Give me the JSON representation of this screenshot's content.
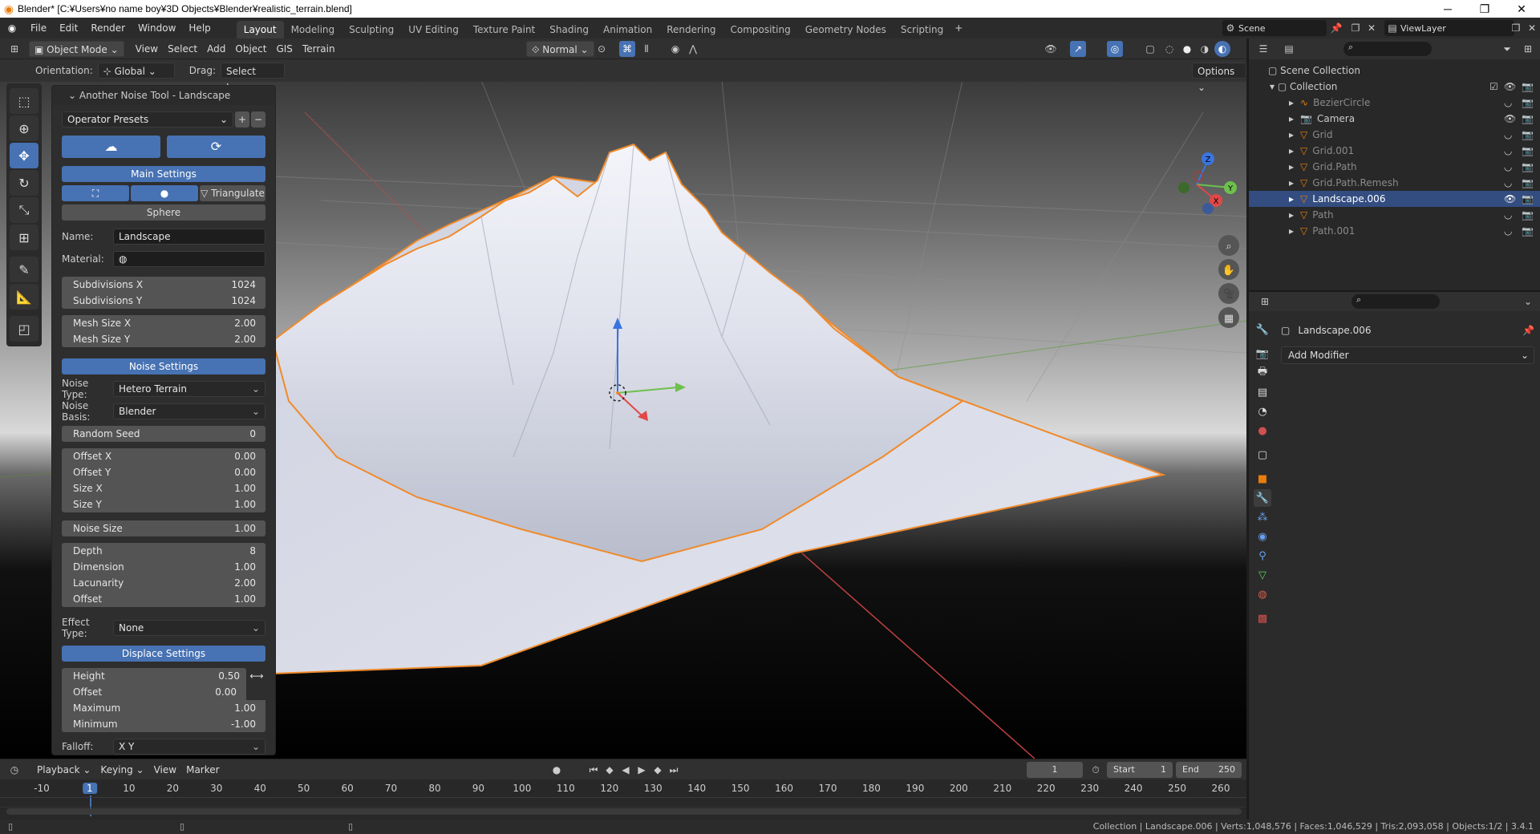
{
  "window": {
    "title": "Blender* [C:¥Users¥no name boy¥3D Objects¥Blender¥realistic_terrain.blend]"
  },
  "menu": [
    "File",
    "Edit",
    "Render",
    "Window",
    "Help"
  ],
  "workspaces": [
    "Layout",
    "Modeling",
    "Sculpting",
    "UV Editing",
    "Texture Paint",
    "Shading",
    "Animation",
    "Rendering",
    "Compositing",
    "Geometry Nodes",
    "Scripting"
  ],
  "scene": {
    "scene_name": "Scene",
    "view_layer": "ViewLayer"
  },
  "viewport_header": {
    "mode": "Object Mode",
    "menus": [
      "View",
      "Select",
      "Add",
      "Object",
      "GIS",
      "Terrain"
    ],
    "transform_orientation": "Normal"
  },
  "tool_header": {
    "orientation_label": "Orientation:",
    "orientation_value": "Global",
    "drag_label": "Drag:",
    "drag_value": "Select La...",
    "options_label": "Options"
  },
  "operator_panel": {
    "title": "Another Noise Tool - Landscape",
    "presets_label": "Operator Presets",
    "main_settings": "Main Settings",
    "triangulate": "Triangulate",
    "sphere": "Sphere",
    "name_label": "Name:",
    "name_value": "Landscape",
    "material_label": "Material:",
    "subdiv_x_label": "Subdivisions X",
    "subdiv_x": "1024",
    "subdiv_y_label": "Subdivisions Y",
    "subdiv_y": "1024",
    "mesh_x_label": "Mesh Size X",
    "mesh_x": "2.00",
    "mesh_y_label": "Mesh Size Y",
    "mesh_y": "2.00",
    "noise_settings": "Noise Settings",
    "noise_type_label": "Noise Type:",
    "noise_type": "Hetero Terrain",
    "noise_basis_label": "Noise Basis:",
    "noise_basis": "Blender",
    "seed_label": "Random Seed",
    "seed": "0",
    "offset_x_label": "Offset X",
    "offset_x": "0.00",
    "offset_y_label": "Offset Y",
    "offset_y": "0.00",
    "size_x_label": "Size X",
    "size_x": "1.00",
    "size_y_label": "Size Y",
    "size_y": "1.00",
    "noise_size_label": "Noise Size",
    "noise_size": "1.00",
    "depth_label": "Depth",
    "depth": "8",
    "dimension_label": "Dimension",
    "dimension": "1.00",
    "lacunarity_label": "Lacunarity",
    "lacunarity": "2.00",
    "offset_label": "Offset",
    "offset": "1.00",
    "effect_type_label": "Effect Type:",
    "effect_type": "None",
    "displace_settings": "Displace Settings",
    "height_label": "Height",
    "height": "0.50",
    "d_offset_label": "Offset",
    "d_offset": "0.00",
    "maximum_label": "Maximum",
    "maximum": "1.00",
    "minimum_label": "Minimum",
    "minimum": "-1.00",
    "falloff_label": "Falloff:",
    "falloff": "X Y"
  },
  "timeline": {
    "menus": [
      "Playback",
      "Keying",
      "View",
      "Marker"
    ],
    "current_frame": "1",
    "start_label": "Start",
    "start": "1",
    "end_label": "End",
    "end": "250",
    "ticks": [
      "-10",
      "1",
      "10",
      "20",
      "30",
      "40",
      "50",
      "60",
      "70",
      "80",
      "90",
      "100",
      "110",
      "120",
      "130",
      "140",
      "150",
      "160",
      "170",
      "180",
      "190",
      "200",
      "210",
      "220",
      "230",
      "240",
      "250",
      "260"
    ]
  },
  "outliner": {
    "root": "Scene Collection",
    "collection": "Collection",
    "items": [
      "BezierCircle",
      "Camera",
      "Grid",
      "Grid.001",
      "Grid.Path",
      "Grid.Path.Remesh",
      "Landscape.006",
      "Path",
      "Path.001"
    ],
    "selected": "Landscape.006"
  },
  "properties": {
    "object_name": "Landscape.006",
    "add_modifier": "Add Modifier"
  },
  "status": "Collection | Landscape.006 | Verts:1,048,576 | Faces:1,046,529 | Tris:2,093,058 | Objects:1/2 | 3.4.1",
  "colors": {
    "accent": "#4772b3",
    "selection_outline": "#f08a2b",
    "active_row": "#334d80"
  }
}
